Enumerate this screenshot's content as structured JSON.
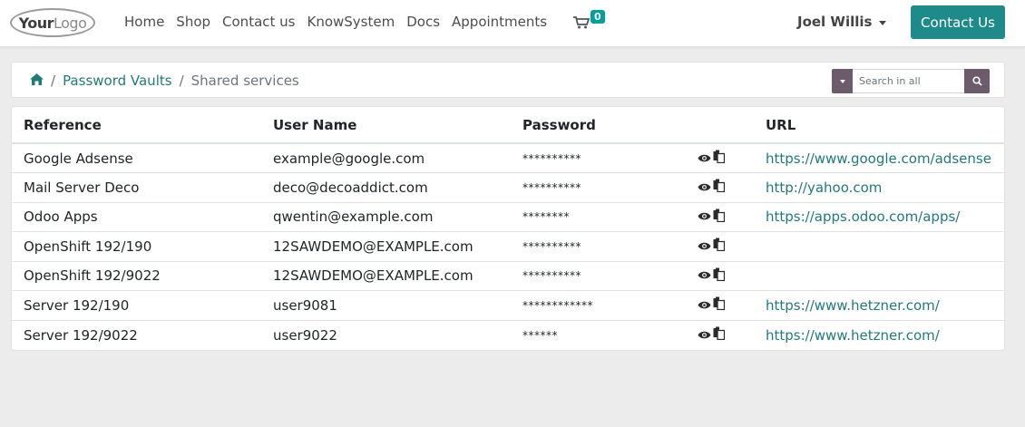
{
  "logo": {
    "text_bold": "Your",
    "text_light": "Logo"
  },
  "nav": {
    "links": [
      "Home",
      "Shop",
      "Contact us",
      "KnowSystem",
      "Docs",
      "Appointments"
    ],
    "cart_count": "0",
    "user_name": "Joel Willis",
    "contact_button": "Contact Us"
  },
  "breadcrumb": {
    "items": [
      "Password Vaults",
      "Shared services"
    ],
    "separator": "/"
  },
  "search": {
    "placeholder": "Search in all"
  },
  "table": {
    "headers": [
      "Reference",
      "User Name",
      "Password",
      "URL"
    ],
    "rows": [
      {
        "reference": "Google Adsense",
        "user": "example@google.com",
        "password": "**********",
        "url": "https://www.google.com/adsense"
      },
      {
        "reference": "Mail Server Deco",
        "user": "deco@decoaddict.com",
        "password": "**********",
        "url": "http://yahoo.com"
      },
      {
        "reference": "Odoo Apps",
        "user": "qwentin@example.com",
        "password": "********",
        "url": "https://apps.odoo.com/apps/"
      },
      {
        "reference": "OpenShift 192/190",
        "user": "12SAWDEMO@EXAMPLE.com",
        "password": "**********",
        "url": ""
      },
      {
        "reference": "OpenShift 192/9022",
        "user": "12SAWDEMO@EXAMPLE.com",
        "password": "**********",
        "url": ""
      },
      {
        "reference": "Server 192/190",
        "user": "user9081",
        "password": "************",
        "url": "https://www.hetzner.com/"
      },
      {
        "reference": "Server 192/9022",
        "user": "user9022",
        "password": "******",
        "url": "https://www.hetzner.com/"
      }
    ]
  },
  "icons": {
    "home": "home-icon",
    "cart": "cart-icon",
    "search": "search-icon",
    "show": "eye-icon",
    "copy": "copy-icon"
  },
  "colors": {
    "accent": "#1f8a8a",
    "link": "#217a7a",
    "search_button": "#6b5b6b",
    "badge": "#00a09d"
  }
}
